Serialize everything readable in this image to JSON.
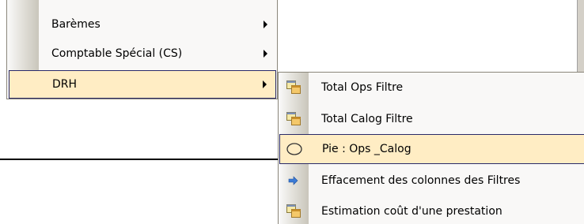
{
  "main_menu": {
    "items": [
      {
        "label": "Barèmes",
        "has_submenu": true
      },
      {
        "label": "Comptable Spécial (CS)",
        "has_submenu": true
      },
      {
        "label": "DRH",
        "has_submenu": true,
        "selected": true
      }
    ]
  },
  "submenu": {
    "items": [
      {
        "label": "Total Ops Filtre",
        "icon": "stacked-windows-icon"
      },
      {
        "label": "Total Calog Filtre",
        "icon": "stacked-windows-icon"
      },
      {
        "label": "Pie : Ops _Calog",
        "icon": "ellipse-icon",
        "selected": true
      },
      {
        "label": "Effacement des colonnes des Filtres",
        "icon": "blue-arrow-icon"
      },
      {
        "label": "Estimation coût d'une prestation",
        "icon": "stacked-windows-icon"
      }
    ]
  },
  "colors": {
    "menu_bg": "#f9f8f7",
    "highlight_bg": "#ffedc4",
    "highlight_border": "#2a2a68",
    "arrow_icon": "#3b7bd6"
  }
}
